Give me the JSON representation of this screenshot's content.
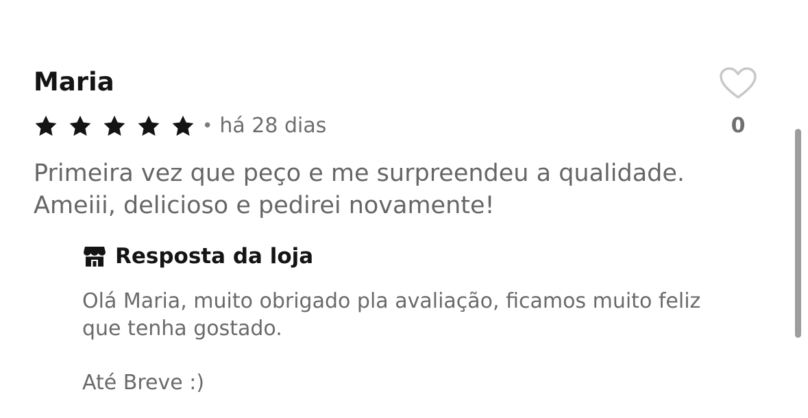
{
  "review": {
    "reviewer_name": "Maria",
    "rating": 5,
    "rating_max": 5,
    "separator": "•",
    "time_ago": "há 28 dias",
    "text_line1": "Primeira vez que peço e me surpreendeu a qualidade.",
    "text_line2": "Ameiii, delicioso e pedirei novamente!",
    "likes": "0",
    "like_icon": "heart-outline-icon",
    "star_icon": "star-filled-icon",
    "star_color": "#141414"
  },
  "store_reply": {
    "icon": "store-icon",
    "title": "Resposta da loja",
    "text_line1": "Olá Maria, muito obrigado pla avaliação, ficamos muito feliz",
    "text_line2": "que tenha gostado.",
    "closing": "Até Breve :)"
  },
  "colors": {
    "primary_text": "#141414",
    "secondary_text": "#6a6a6a",
    "heart_outline": "#c8c8c8",
    "scrollbar": "#9d9d9d"
  }
}
